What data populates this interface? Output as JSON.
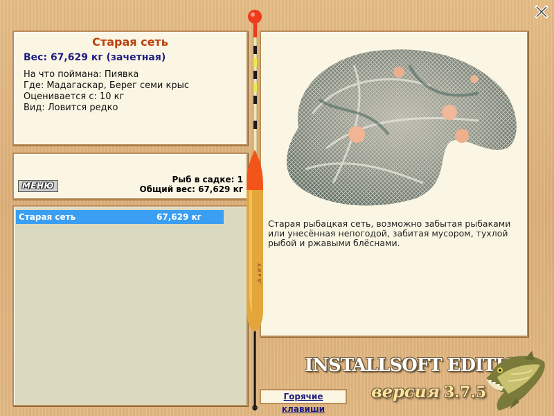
{
  "fish_info": {
    "name": "Старая сеть",
    "weight_line": "Вес: 67,629 кг (зачетная)",
    "caught_on": "На что поймана: Пиявка",
    "where": "Где: Мадагаскар, Берег семи крыс",
    "rated_from": "Оценивается с: 10 кг",
    "type": "Вид: Ловится редко"
  },
  "summary": {
    "menu_label": "МЕНЮ",
    "fish_count": "Рыб в садке: 1",
    "total_weight": "Общий вес: 67,629 кг"
  },
  "catch_list": [
    {
      "name": "Старая сеть",
      "weight": "67,629 кг"
    }
  ],
  "detail": {
    "description": "Старая рыбацкая сеть, возможно забытая рыбаками или унесённая непогодой, забитая мусором, тухлой рыбой и ржавыми блёснами."
  },
  "footer": {
    "hotkeys_label": "Горячие клавиши",
    "brand_title": "INSTALLSOFT EDITION",
    "version_word": "версия",
    "version_number": "3.7.5"
  },
  "float_marking": "А И Р 3Г",
  "colors": {
    "title": "#b9410f",
    "weight": "#1e1e82",
    "selection": "#3a9ef2",
    "panel": "#fbf6e4",
    "list_bg": "#dcd9c1"
  },
  "icons": [
    "close-icon",
    "fishing-float-icon",
    "pike-fish-icon",
    "fishing-net-image"
  ]
}
